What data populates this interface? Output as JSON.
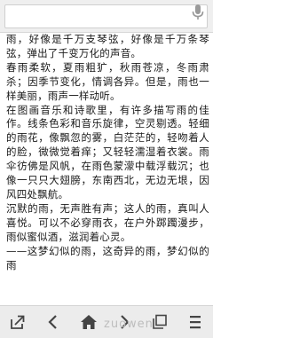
{
  "search": {
    "value": ""
  },
  "article": {
    "paragraphs": [
      "雨，好像是千万支琴弦，好像是千万条琴弦，弹出了千变万化的声音。",
      "春雨柔软，夏雨粗犷，秋雨苍凉，冬雨肃杀；因季节变化，情调各异。但是，雨也一样美丽，雨声一样动听。",
      "在图画音乐和诗歌里，有许多描写雨的佳作。线条色彩和音乐旋律，空灵剔透。轻细的雨花，像飘忽的雾，白茫茫的，轻吻着人的脸，微微觉着痒；又轻轻濡湿着衣裳。雨伞彷佛是风帆，在雨色蒙濛中载浮载沉；也像一只只大翅膀，东南西北，无边无垠，因风四处飘航。",
      "沉默的雨，无声胜有声；这人的雨，真叫人喜悦。可以不必穿雨衣，在户外踯躅漫步，雨似蜜似酒，滋润着心灵。",
      "——这梦幻似的雨，这奇异的雨，梦幻似的雨"
    ]
  },
  "watermark": "zuowen"
}
